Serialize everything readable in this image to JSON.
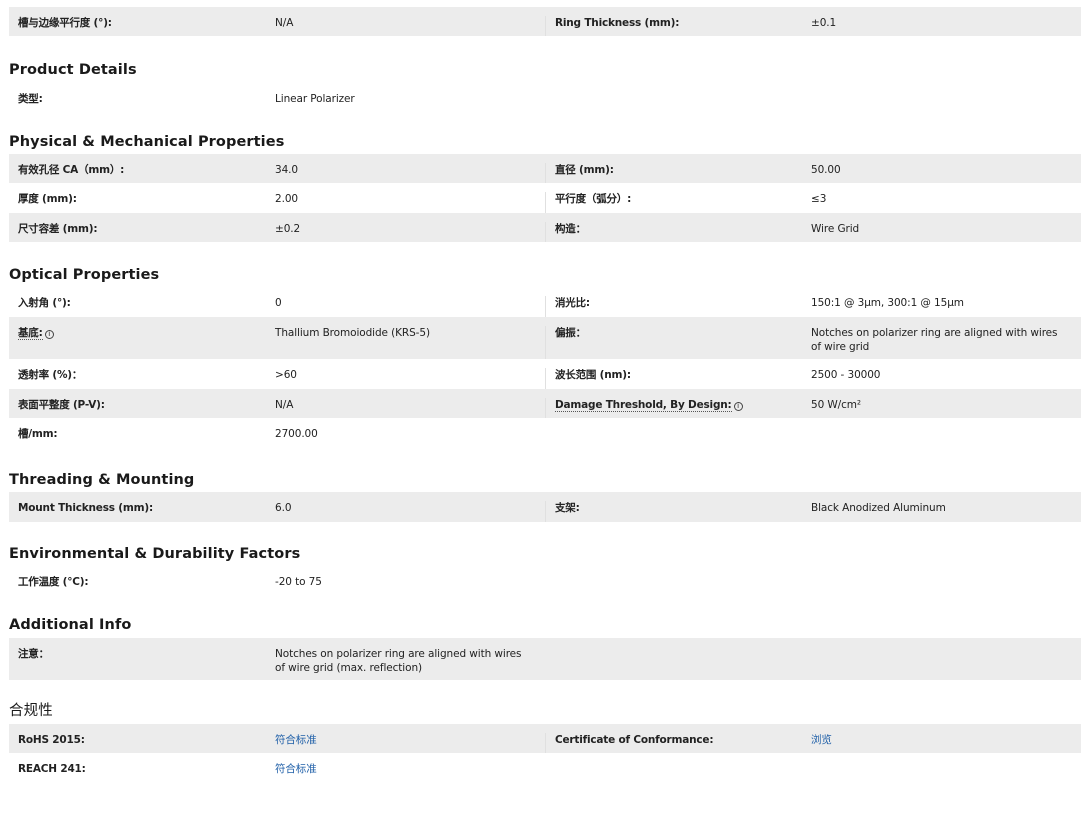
{
  "top_row": {
    "l_label": "槽与边缘平行度 (°):",
    "l_value": "N/A",
    "r_label": "Ring Thickness (mm):",
    "r_value": "±0.1"
  },
  "product_details": {
    "title": "Product Details",
    "rows": [
      {
        "l_label": "类型:",
        "l_value": "Linear Polarizer"
      }
    ]
  },
  "physical": {
    "title": "Physical & Mechanical Properties",
    "rows": [
      {
        "l_label": "有效孔径 CA（mm）:",
        "l_value": "34.0",
        "r_label": "直径 (mm):",
        "r_value": "50.00"
      },
      {
        "l_label": "厚度 (mm):",
        "l_value": "2.00",
        "r_label": "平行度（弧分）:",
        "r_value": "≤3"
      },
      {
        "l_label": "尺寸容差 (mm):",
        "l_value": "±0.2",
        "r_label": "构造：",
        "r_value": "Wire Grid"
      }
    ]
  },
  "optical": {
    "title": "Optical Properties",
    "rows": [
      {
        "l_label": "入射角 (°):",
        "l_value": "0",
        "r_label": "消光比:",
        "r_value": "150:1 @ 3μm, 300:1 @ 15μm"
      },
      {
        "l_label": "基底:",
        "l_info": "i",
        "l_value": "Thallium Bromoiodide (KRS-5)",
        "r_label": "偏振：",
        "r_value": "Notches on polarizer ring are aligned with wires of wire grid"
      },
      {
        "l_label": "透射率 (%)：",
        "l_value": ">60",
        "r_label": "波长范围 (nm):",
        "r_value": "2500 - 30000"
      },
      {
        "l_label": "表面平整度 (P-V):",
        "l_value": "N/A",
        "r_label": "Damage Threshold, By Design:",
        "r_info": "i",
        "r_value": "50 W/cm²"
      },
      {
        "l_label": "槽/mm:",
        "l_value": "2700.00"
      }
    ]
  },
  "threading": {
    "title": "Threading & Mounting",
    "rows": [
      {
        "l_label": "Mount Thickness (mm):",
        "l_value": "6.0",
        "r_label": "支架:",
        "r_value": "Black Anodized Aluminum"
      }
    ]
  },
  "environmental": {
    "title": "Environmental & Durability Factors",
    "rows": [
      {
        "l_label": "工作温度 (°C):",
        "l_value": "-20 to 75"
      }
    ]
  },
  "additional": {
    "title": "Additional Info",
    "rows": [
      {
        "l_label": "注意：",
        "l_value": "Notches on polarizer ring are aligned with wires of wire grid (max. reflection)"
      }
    ]
  },
  "compliance": {
    "title": "合规性",
    "rows": [
      {
        "l_label": "RoHS 2015:",
        "l_value": "符合标准",
        "r_label": "Certificate of Conformance:",
        "r_value": "浏览"
      },
      {
        "l_label": "REACH 241:",
        "l_value": "符合标准"
      }
    ]
  }
}
